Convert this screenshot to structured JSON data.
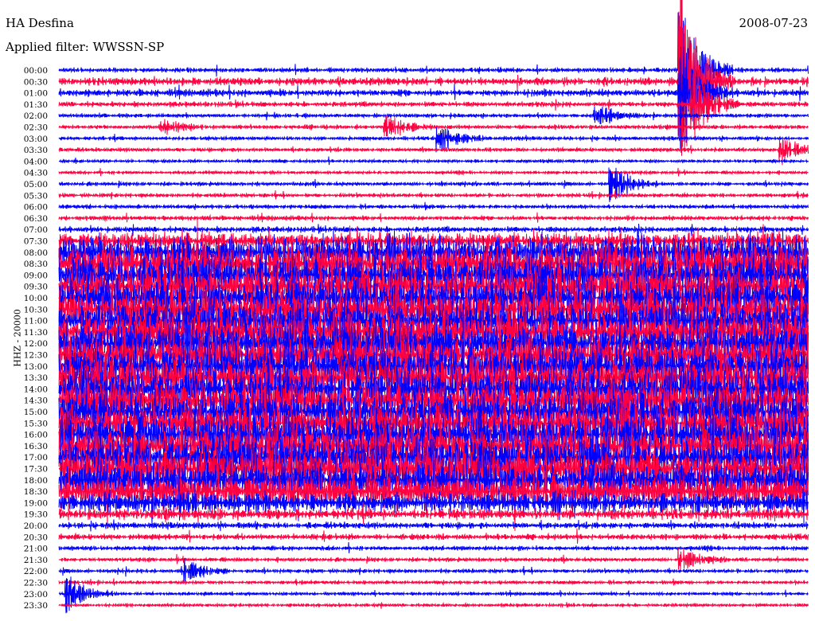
{
  "header": {
    "station": "HA Desfina",
    "date": "2008-07-23",
    "filter": "Applied filter: WWSSN-SP",
    "channel": "HHZ - 20000"
  },
  "chart_data": {
    "type": "line",
    "title": "HA Desfina",
    "subtitle": "Applied filter: WWSSN-SP",
    "ylabel": "HHZ - 20000",
    "xlabel": "",
    "minutes_per_line": 30,
    "colors": [
      "#0000ff",
      "#ff0040"
    ],
    "row_labels": [
      "00:00",
      "00:30",
      "01:00",
      "01:30",
      "02:00",
      "02:30",
      "03:00",
      "03:30",
      "04:00",
      "04:30",
      "05:00",
      "05:30",
      "06:00",
      "06:30",
      "07:00",
      "07:30",
      "08:00",
      "08:30",
      "09:00",
      "09:30",
      "10:00",
      "10:30",
      "11:00",
      "11:30",
      "12:00",
      "12:30",
      "13:00",
      "13:30",
      "14:00",
      "14:30",
      "15:00",
      "15:30",
      "16:00",
      "16:30",
      "17:00",
      "17:30",
      "18:00",
      "18:30",
      "19:00",
      "19:30",
      "20:00",
      "20:30",
      "21:00",
      "21:30",
      "22:00",
      "22:30",
      "23:00",
      "23:30"
    ],
    "relative_amplitude": [
      0.35,
      0.6,
      0.55,
      0.4,
      0.3,
      0.3,
      0.3,
      0.3,
      0.25,
      0.25,
      0.3,
      0.3,
      0.3,
      0.35,
      0.45,
      1.2,
      2.5,
      3,
      3,
      3,
      3,
      3,
      3,
      3,
      3,
      3,
      3,
      3,
      3,
      3,
      3,
      3,
      3,
      3,
      3,
      3,
      2.8,
      2.5,
      1.6,
      0.8,
      0.5,
      0.45,
      0.35,
      0.3,
      0.3,
      0.25,
      0.25,
      0.25
    ],
    "events": [
      {
        "row": "00:00",
        "minute": 25,
        "amplitude": 6
      },
      {
        "row": "00:30",
        "minute": 25,
        "amplitude": 8
      },
      {
        "row": "01:00",
        "minute": 25,
        "amplitude": 5
      },
      {
        "row": "01:30",
        "minute": 25.5,
        "amplitude": 3
      },
      {
        "row": "02:00",
        "minute": 21.6,
        "amplitude": 1
      },
      {
        "row": "02:30",
        "minute": 4.2,
        "amplitude": 0.8
      },
      {
        "row": "02:30",
        "minute": 13.2,
        "amplitude": 1.2
      },
      {
        "row": "03:00",
        "minute": 15.3,
        "amplitude": 1.2
      },
      {
        "row": "03:30",
        "minute": 29,
        "amplitude": 1.2
      },
      {
        "row": "05:00",
        "minute": 22.2,
        "amplitude": 1.6
      },
      {
        "row": "21:30",
        "minute": 25,
        "amplitude": 1
      },
      {
        "row": "22:00",
        "minute": 5.1,
        "amplitude": 1.2
      },
      {
        "row": "23:00",
        "minute": 0.4,
        "amplitude": 1.8
      }
    ]
  }
}
